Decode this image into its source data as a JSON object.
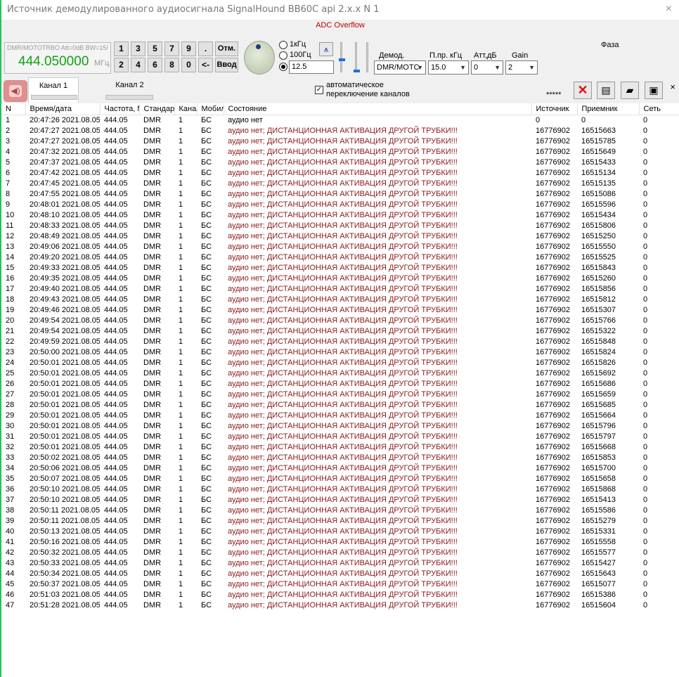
{
  "window": {
    "title": "Источник демодулированного аудиосигнала SignalHound BB60C api 2.x.x N 1",
    "close_glyph": "×"
  },
  "status": {
    "text": "ADC Overflow",
    "color": "#c00000"
  },
  "freq": {
    "mode": "DMR/MOTOTRBO Att=0dB BW=15/",
    "value": "444.050000",
    "unit": "МГц"
  },
  "keypad": {
    "row1": [
      "1",
      "3",
      "5",
      "7",
      "9",
      "."
    ],
    "row2": [
      "2",
      "4",
      "6",
      "8",
      "0",
      "<-"
    ],
    "cancel": "Отм.",
    "enter": "Ввод"
  },
  "step": {
    "opt1": "1кГц",
    "opt2": "100Гц",
    "custom_value": "12.5",
    "selected": "custom"
  },
  "filter_icon": "antenna-filter-icon",
  "controls": {
    "demod_label": "Демод.",
    "demod_value": "DMR/MOTC",
    "bw_label": "П.пр. кГц",
    "bw_value": "15.0",
    "att_label": "Атт,дБ",
    "att_value": "0",
    "gain_label": "Gain",
    "gain_value": "2",
    "phase_label": "Фаза"
  },
  "tabs": {
    "ch1": "Канал 1",
    "ch2": "Канал 2"
  },
  "auto_switch": {
    "line1": "автоматическое",
    "line2": "переключение каналов",
    "checked": "✓"
  },
  "stars": "*****",
  "tab_close": "×",
  "columns": [
    "N",
    "Время/дата",
    "Частота, М",
    "Стандарт",
    "Канал",
    "Мобил",
    "Состояние",
    "Источник",
    "Приемник",
    "Сеть"
  ],
  "rows": [
    [
      "1",
      "20:47:26 2021.08.05",
      "444.05",
      "DMR",
      "1",
      "БС",
      "аудио нет",
      "0",
      "0",
      "0"
    ],
    [
      "2",
      "20:47:27 2021.08.05",
      "444.05",
      "DMR",
      "1",
      "БС",
      "аудио нет; ДИСТАНЦИОННАЯ АКТИВАЦИЯ ДРУГОЙ ТРУБКИ!!!",
      "16776902",
      "16515663",
      "0"
    ],
    [
      "3",
      "20:47:27 2021.08.05",
      "444.05",
      "DMR",
      "1",
      "БС",
      "аудио нет; ДИСТАНЦИОННАЯ АКТИВАЦИЯ ДРУГОЙ ТРУБКИ!!!",
      "16776902",
      "16515785",
      "0"
    ],
    [
      "4",
      "20:47:32 2021.08.05",
      "444.05",
      "DMR",
      "1",
      "БС",
      "аудио нет; ДИСТАНЦИОННАЯ АКТИВАЦИЯ ДРУГОЙ ТРУБКИ!!!",
      "16776902",
      "16515649",
      "0"
    ],
    [
      "5",
      "20:47:37 2021.08.05",
      "444.05",
      "DMR",
      "1",
      "БС",
      "аудио нет; ДИСТАНЦИОННАЯ АКТИВАЦИЯ ДРУГОЙ ТРУБКИ!!!",
      "16776902",
      "16515433",
      "0"
    ],
    [
      "6",
      "20:47:42 2021.08.05",
      "444.05",
      "DMR",
      "1",
      "БС",
      "аудио нет; ДИСТАНЦИОННАЯ АКТИВАЦИЯ ДРУГОЙ ТРУБКИ!!!",
      "16776902",
      "16515134",
      "0"
    ],
    [
      "7",
      "20:47:45 2021.08.05",
      "444.05",
      "DMR",
      "1",
      "БС",
      "аудио нет; ДИСТАНЦИОННАЯ АКТИВАЦИЯ ДРУГОЙ ТРУБКИ!!!",
      "16776902",
      "16515135",
      "0"
    ],
    [
      "8",
      "20:47:55 2021.08.05",
      "444.05",
      "DMR",
      "1",
      "БС",
      "аудио нет; ДИСТАНЦИОННАЯ АКТИВАЦИЯ ДРУГОЙ ТРУБКИ!!!",
      "16776902",
      "16515086",
      "0"
    ],
    [
      "9",
      "20:48:01 2021.08.05",
      "444.05",
      "DMR",
      "1",
      "БС",
      "аудио нет; ДИСТАНЦИОННАЯ АКТИВАЦИЯ ДРУГОЙ ТРУБКИ!!!",
      "16776902",
      "16515596",
      "0"
    ],
    [
      "10",
      "20:48:10 2021.08.05",
      "444.05",
      "DMR",
      "1",
      "БС",
      "аудио нет; ДИСТАНЦИОННАЯ АКТИВАЦИЯ ДРУГОЙ ТРУБКИ!!!",
      "16776902",
      "16515434",
      "0"
    ],
    [
      "11",
      "20:48:33 2021.08.05",
      "444.05",
      "DMR",
      "1",
      "БС",
      "аудио нет; ДИСТАНЦИОННАЯ АКТИВАЦИЯ ДРУГОЙ ТРУБКИ!!!",
      "16776902",
      "16515806",
      "0"
    ],
    [
      "12",
      "20:48:49 2021.08.05",
      "444.05",
      "DMR",
      "1",
      "БС",
      "аудио нет; ДИСТАНЦИОННАЯ АКТИВАЦИЯ ДРУГОЙ ТРУБКИ!!!",
      "16776902",
      "16515250",
      "0"
    ],
    [
      "13",
      "20:49:06 2021.08.05",
      "444.05",
      "DMR",
      "1",
      "БС",
      "аудио нет; ДИСТАНЦИОННАЯ АКТИВАЦИЯ ДРУГОЙ ТРУБКИ!!!",
      "16776902",
      "16515550",
      "0"
    ],
    [
      "14",
      "20:49:20 2021.08.05",
      "444.05",
      "DMR",
      "1",
      "БС",
      "аудио нет; ДИСТАНЦИОННАЯ АКТИВАЦИЯ ДРУГОЙ ТРУБКИ!!!",
      "16776902",
      "16515525",
      "0"
    ],
    [
      "15",
      "20:49:33 2021.08.05",
      "444.05",
      "DMR",
      "1",
      "БС",
      "аудио нет; ДИСТАНЦИОННАЯ АКТИВАЦИЯ ДРУГОЙ ТРУБКИ!!!",
      "16776902",
      "16515843",
      "0"
    ],
    [
      "16",
      "20:49:35 2021.08.05",
      "444.05",
      "DMR",
      "1",
      "БС",
      "аудио нет; ДИСТАНЦИОННАЯ АКТИВАЦИЯ ДРУГОЙ ТРУБКИ!!!",
      "16776902",
      "16515260",
      "0"
    ],
    [
      "17",
      "20:49:40 2021.08.05",
      "444.05",
      "DMR",
      "1",
      "БС",
      "аудио нет; ДИСТАНЦИОННАЯ АКТИВАЦИЯ ДРУГОЙ ТРУБКИ!!!",
      "16776902",
      "16515856",
      "0"
    ],
    [
      "18",
      "20:49:43 2021.08.05",
      "444.05",
      "DMR",
      "1",
      "БС",
      "аудио нет; ДИСТАНЦИОННАЯ АКТИВАЦИЯ ДРУГОЙ ТРУБКИ!!!",
      "16776902",
      "16515812",
      "0"
    ],
    [
      "19",
      "20:49:46 2021.08.05",
      "444.05",
      "DMR",
      "1",
      "БС",
      "аудио нет; ДИСТАНЦИОННАЯ АКТИВАЦИЯ ДРУГОЙ ТРУБКИ!!!",
      "16776902",
      "16515307",
      "0"
    ],
    [
      "20",
      "20:49:54 2021.08.05",
      "444.05",
      "DMR",
      "1",
      "БС",
      "аудио нет; ДИСТАНЦИОННАЯ АКТИВАЦИЯ ДРУГОЙ ТРУБКИ!!!",
      "16776902",
      "16515766",
      "0"
    ],
    [
      "21",
      "20:49:54 2021.08.05",
      "444.05",
      "DMR",
      "1",
      "БС",
      "аудио нет; ДИСТАНЦИОННАЯ АКТИВАЦИЯ ДРУГОЙ ТРУБКИ!!!",
      "16776902",
      "16515322",
      "0"
    ],
    [
      "22",
      "20:49:59 2021.08.05",
      "444.05",
      "DMR",
      "1",
      "БС",
      "аудио нет; ДИСТАНЦИОННАЯ АКТИВАЦИЯ ДРУГОЙ ТРУБКИ!!!",
      "16776902",
      "16515848",
      "0"
    ],
    [
      "23",
      "20:50:00 2021.08.05",
      "444.05",
      "DMR",
      "1",
      "БС",
      "аудио нет; ДИСТАНЦИОННАЯ АКТИВАЦИЯ ДРУГОЙ ТРУБКИ!!!",
      "16776902",
      "16515824",
      "0"
    ],
    [
      "24",
      "20:50:01 2021.08.05",
      "444.05",
      "DMR",
      "1",
      "БС",
      "аудио нет; ДИСТАНЦИОННАЯ АКТИВАЦИЯ ДРУГОЙ ТРУБКИ!!!",
      "16776902",
      "16515826",
      "0"
    ],
    [
      "25",
      "20:50:01 2021.08.05",
      "444.05",
      "DMR",
      "1",
      "БС",
      "аудио нет; ДИСТАНЦИОННАЯ АКТИВАЦИЯ ДРУГОЙ ТРУБКИ!!!",
      "16776902",
      "16515692",
      "0"
    ],
    [
      "26",
      "20:50:01 2021.08.05",
      "444.05",
      "DMR",
      "1",
      "БС",
      "аудио нет; ДИСТАНЦИОННАЯ АКТИВАЦИЯ ДРУГОЙ ТРУБКИ!!!",
      "16776902",
      "16515686",
      "0"
    ],
    [
      "27",
      "20:50:01 2021.08.05",
      "444.05",
      "DMR",
      "1",
      "БС",
      "аудио нет; ДИСТАНЦИОННАЯ АКТИВАЦИЯ ДРУГОЙ ТРУБКИ!!!",
      "16776902",
      "16515659",
      "0"
    ],
    [
      "28",
      "20:50:01 2021.08.05",
      "444.05",
      "DMR",
      "1",
      "БС",
      "аудио нет; ДИСТАНЦИОННАЯ АКТИВАЦИЯ ДРУГОЙ ТРУБКИ!!!",
      "16776902",
      "16515685",
      "0"
    ],
    [
      "29",
      "20:50:01 2021.08.05",
      "444.05",
      "DMR",
      "1",
      "БС",
      "аудио нет; ДИСТАНЦИОННАЯ АКТИВАЦИЯ ДРУГОЙ ТРУБКИ!!!",
      "16776902",
      "16515664",
      "0"
    ],
    [
      "30",
      "20:50:01 2021.08.05",
      "444.05",
      "DMR",
      "1",
      "БС",
      "аудио нет; ДИСТАНЦИОННАЯ АКТИВАЦИЯ ДРУГОЙ ТРУБКИ!!!",
      "16776902",
      "16515796",
      "0"
    ],
    [
      "31",
      "20:50:01 2021.08.05",
      "444.05",
      "DMR",
      "1",
      "БС",
      "аудио нет; ДИСТАНЦИОННАЯ АКТИВАЦИЯ ДРУГОЙ ТРУБКИ!!!",
      "16776902",
      "16515797",
      "0"
    ],
    [
      "32",
      "20:50:01 2021.08.05",
      "444.05",
      "DMR",
      "1",
      "БС",
      "аудио нет; ДИСТАНЦИОННАЯ АКТИВАЦИЯ ДРУГОЙ ТРУБКИ!!!",
      "16776902",
      "16515668",
      "0"
    ],
    [
      "33",
      "20:50:02 2021.08.05",
      "444.05",
      "DMR",
      "1",
      "БС",
      "аудио нет; ДИСТАНЦИОННАЯ АКТИВАЦИЯ ДРУГОЙ ТРУБКИ!!!",
      "16776902",
      "16515853",
      "0"
    ],
    [
      "34",
      "20:50:06 2021.08.05",
      "444.05",
      "DMR",
      "1",
      "БС",
      "аудио нет; ДИСТАНЦИОННАЯ АКТИВАЦИЯ ДРУГОЙ ТРУБКИ!!!",
      "16776902",
      "16515700",
      "0"
    ],
    [
      "35",
      "20:50:07 2021.08.05",
      "444.05",
      "DMR",
      "1",
      "БС",
      "аудио нет; ДИСТАНЦИОННАЯ АКТИВАЦИЯ ДРУГОЙ ТРУБКИ!!!",
      "16776902",
      "16515658",
      "0"
    ],
    [
      "36",
      "20:50:10 2021.08.05",
      "444.05",
      "DMR",
      "1",
      "БС",
      "аудио нет; ДИСТАНЦИОННАЯ АКТИВАЦИЯ ДРУГОЙ ТРУБКИ!!!",
      "16776902",
      "16515868",
      "0"
    ],
    [
      "37",
      "20:50:10 2021.08.05",
      "444.05",
      "DMR",
      "1",
      "БС",
      "аудио нет; ДИСТАНЦИОННАЯ АКТИВАЦИЯ ДРУГОЙ ТРУБКИ!!!",
      "16776902",
      "16515413",
      "0"
    ],
    [
      "38",
      "20:50:11 2021.08.05",
      "444.05",
      "DMR",
      "1",
      "БС",
      "аудио нет; ДИСТАНЦИОННАЯ АКТИВАЦИЯ ДРУГОЙ ТРУБКИ!!!",
      "16776902",
      "16515586",
      "0"
    ],
    [
      "39",
      "20:50:11 2021.08.05",
      "444.05",
      "DMR",
      "1",
      "БС",
      "аудио нет; ДИСТАНЦИОННАЯ АКТИВАЦИЯ ДРУГОЙ ТРУБКИ!!!",
      "16776902",
      "16515279",
      "0"
    ],
    [
      "40",
      "20:50:13 2021.08.05",
      "444.05",
      "DMR",
      "1",
      "БС",
      "аудио нет; ДИСТАНЦИОННАЯ АКТИВАЦИЯ ДРУГОЙ ТРУБКИ!!!",
      "16776902",
      "16515331",
      "0"
    ],
    [
      "41",
      "20:50:16 2021.08.05",
      "444.05",
      "DMR",
      "1",
      "БС",
      "аудио нет; ДИСТАНЦИОННАЯ АКТИВАЦИЯ ДРУГОЙ ТРУБКИ!!!",
      "16776902",
      "16515558",
      "0"
    ],
    [
      "42",
      "20:50:32 2021.08.05",
      "444.05",
      "DMR",
      "1",
      "БС",
      "аудио нет; ДИСТАНЦИОННАЯ АКТИВАЦИЯ ДРУГОЙ ТРУБКИ!!!",
      "16776902",
      "16515577",
      "0"
    ],
    [
      "43",
      "20:50:33 2021.08.05",
      "444.05",
      "DMR",
      "1",
      "БС",
      "аудио нет; ДИСТАНЦИОННАЯ АКТИВАЦИЯ ДРУГОЙ ТРУБКИ!!!",
      "16776902",
      "16515427",
      "0"
    ],
    [
      "44",
      "20:50:34 2021.08.05",
      "444.05",
      "DMR",
      "1",
      "БС",
      "аудио нет; ДИСТАНЦИОННАЯ АКТИВАЦИЯ ДРУГОЙ ТРУБКИ!!!",
      "16776902",
      "16515643",
      "0"
    ],
    [
      "45",
      "20:50:37 2021.08.05",
      "444.05",
      "DMR",
      "1",
      "БС",
      "аудио нет; ДИСТАНЦИОННАЯ АКТИВАЦИЯ ДРУГОЙ ТРУБКИ!!!",
      "16776902",
      "16515077",
      "0"
    ],
    [
      "46",
      "20:51:03 2021.08.05",
      "444.05",
      "DMR",
      "1",
      "БС",
      "аудио нет; ДИСТАНЦИОННАЯ АКТИВАЦИЯ ДРУГОЙ ТРУБКИ!!!",
      "16776902",
      "16515386",
      "0"
    ],
    [
      "47",
      "20:51:28 2021.08.05",
      "444.05",
      "DMR",
      "1",
      "БС",
      "аудио нет; ДИСТАНЦИОННАЯ АКТИВАЦИЯ ДРУГОЙ ТРУБКИ!!!",
      "16776902",
      "16515604",
      "0"
    ]
  ]
}
